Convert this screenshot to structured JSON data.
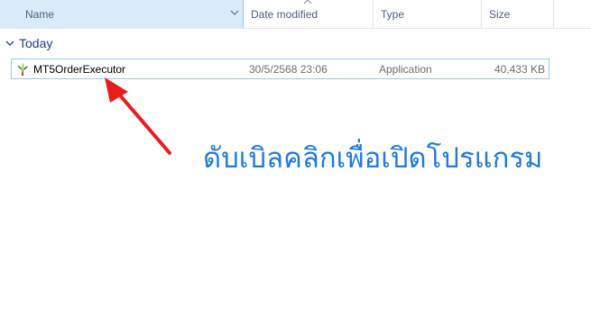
{
  "columns": {
    "name": "Name",
    "date_modified": "Date modified",
    "type": "Type",
    "size": "Size"
  },
  "group": {
    "label": "Today"
  },
  "file": {
    "name": "MT5OrderExecutor",
    "date_modified": "30/5/2568 23:06",
    "type": "Application",
    "size": "40,433 KB",
    "icon": "tree-app-icon"
  },
  "annotation": {
    "text": "ดับเบิลคลิกเพื่อเปิดโปรแกรม",
    "color": "#1e7be0"
  },
  "arrow_color": "#ea1c1c"
}
